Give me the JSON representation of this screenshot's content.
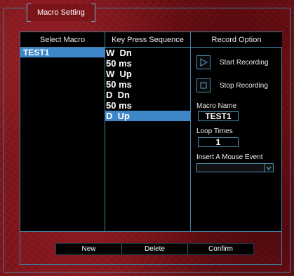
{
  "window": {
    "title": "Macro Setting"
  },
  "columns": {
    "select_macro": "Select Macro",
    "key_sequence": "Key Press Sequence",
    "record_option": "Record Option"
  },
  "macros": [
    {
      "name": "TEST1",
      "selected": true
    }
  ],
  "sequence": [
    {
      "text": "W  Dn",
      "selected": false
    },
    {
      "text": "50 ms",
      "selected": false
    },
    {
      "text": "W  Up",
      "selected": false
    },
    {
      "text": "50 ms",
      "selected": false
    },
    {
      "text": "D  Dn",
      "selected": false
    },
    {
      "text": "50 ms",
      "selected": false
    },
    {
      "text": "D  Up",
      "selected": true
    }
  ],
  "record": {
    "start_label": "Start Recording",
    "stop_label": "Stop Recording",
    "macro_name_label": "Macro Name",
    "macro_name_value": "TEST1",
    "loop_times_label": "Loop Times",
    "loop_times_value": "1",
    "mouse_event_label": "Insert A Mouse Event",
    "mouse_event_value": ""
  },
  "buttons": {
    "new": "New",
    "delete": "Delete",
    "confirm": "Confirm"
  },
  "colors": {
    "background": "#7a1418",
    "accent_border": "#3f7f9f",
    "selection": "#3d87c9"
  },
  "icons": {
    "start": "play-icon",
    "stop": "stop-icon",
    "dropdown": "chevron-down-icon"
  }
}
